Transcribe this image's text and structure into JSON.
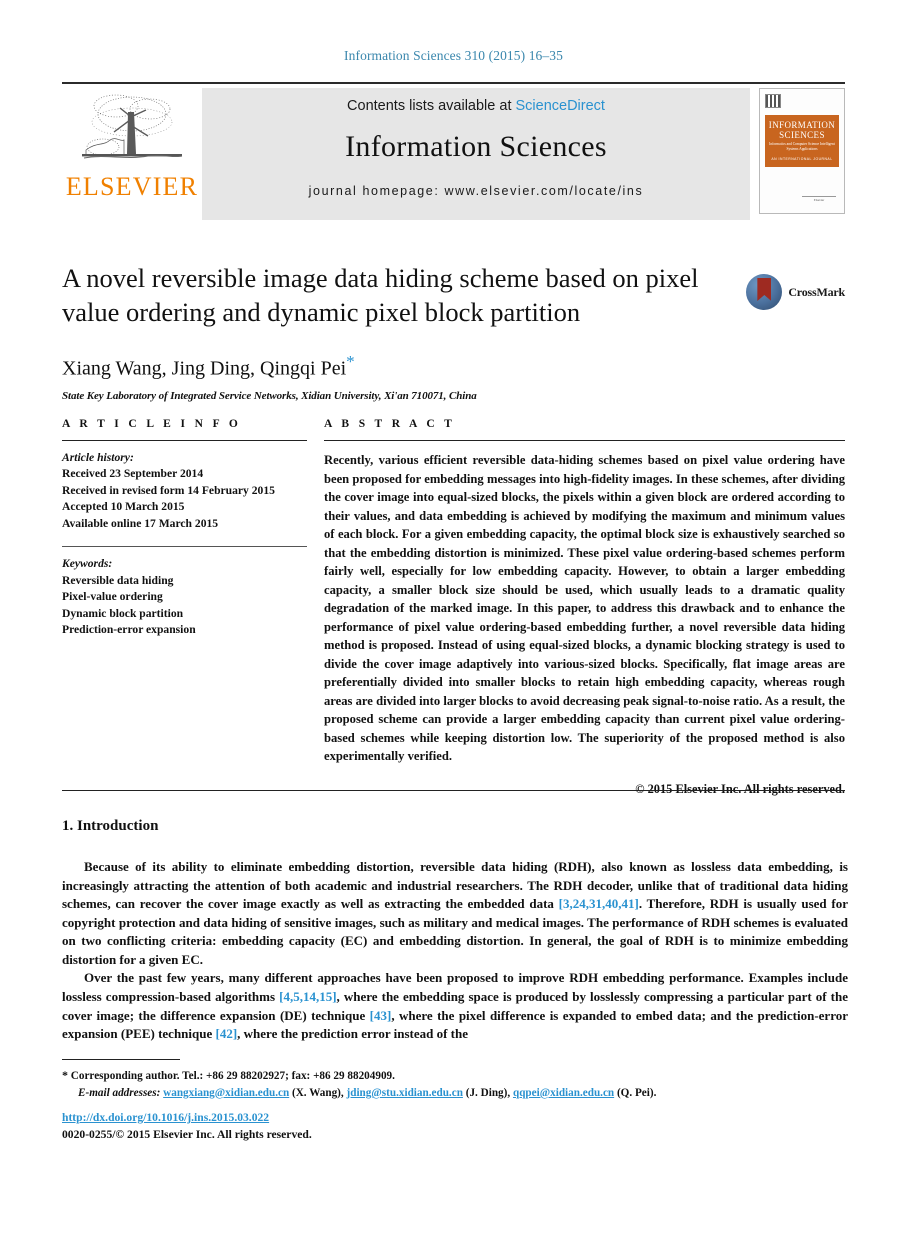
{
  "running_head": "Information Sciences 310 (2015) 16–35",
  "masthead": {
    "contents_prefix": "Contents lists available at ",
    "contents_link": "ScienceDirect",
    "journal_name": "Information Sciences",
    "homepage": "journal homepage: www.elsevier.com/locate/ins",
    "publisher_wordmark": "ELSEVIER",
    "cover": {
      "line1": "INFORMATION",
      "line2": "SCIENCES",
      "line3": "Informatics and Computer Science Intelligent Systems Applications",
      "line4": "AN INTERNATIONAL JOURNAL",
      "footer": "Elsevier"
    }
  },
  "title": "A novel reversible image data hiding scheme based on pixel value ordering and dynamic pixel block partition",
  "authors": "Xiang Wang, Jing Ding, Qingqi Pei",
  "author_star": "*",
  "affiliation": "State Key Laboratory of Integrated Service Networks, Xidian University, Xi'an 710071, China",
  "crossmark_label": "CrossMark",
  "article_info": {
    "heading": "A R T I C L E   I N F O",
    "history_label": "Article history:",
    "history": [
      "Received 23 September 2014",
      "Received in revised form 14 February 2015",
      "Accepted 10 March 2015",
      "Available online 17 March 2015"
    ],
    "keywords_label": "Keywords:",
    "keywords": [
      "Reversible data hiding",
      "Pixel-value ordering",
      "Dynamic block partition",
      "Prediction-error expansion"
    ]
  },
  "abstract": {
    "heading": "A B S T R A C T",
    "text": "Recently, various efficient reversible data-hiding schemes based on pixel value ordering have been proposed for embedding messages into high-fidelity images. In these schemes, after dividing the cover image into equal-sized blocks, the pixels within a given block are ordered according to their values, and data embedding is achieved by modifying the maximum and minimum values of each block. For a given embedding capacity, the optimal block size is exhaustively searched so that the embedding distortion is minimized. These pixel value ordering-based schemes perform fairly well, especially for low embedding capacity. However, to obtain a larger embedding capacity, a smaller block size should be used, which usually leads to a dramatic quality degradation of the marked image. In this paper, to address this drawback and to enhance the performance of pixel value ordering-based embedding further, a novel reversible data hiding method is proposed. Instead of using equal-sized blocks, a dynamic blocking strategy is used to divide the cover image adaptively into various-sized blocks. Specifically, flat image areas are preferentially divided into smaller blocks to retain high embedding capacity, whereas rough areas are divided into larger blocks to avoid decreasing peak signal-to-noise ratio. As a result, the proposed scheme can provide a larger embedding capacity than current pixel value ordering-based schemes while keeping distortion low. The superiority of the proposed method is also experimentally verified.",
    "copyright": "© 2015 Elsevier Inc. All rights reserved."
  },
  "section": {
    "heading": "1. Introduction",
    "para1_a": "Because of its ability to eliminate embedding distortion, reversible data hiding (RDH), also known as lossless data embedding, is increasingly attracting the attention of both academic and industrial researchers. The RDH decoder, unlike that of traditional data hiding schemes, can recover the cover image exactly as well as extracting the embedded data ",
    "para1_ref1": "[3,24,31,40,41]",
    "para1_b": ". Therefore, RDH is usually used for copyright protection and data hiding of sensitive images, such as military and medical images. The performance of RDH schemes is evaluated on two conflicting criteria: embedding capacity (EC) and embedding distortion. In general, the goal of RDH is to minimize embedding distortion for a given EC.",
    "para2_a": "Over the past few years, many different approaches have been proposed to improve RDH embedding performance. Examples include lossless compression-based algorithms ",
    "para2_ref1": "[4,5,14,15]",
    "para2_b": ", where the embedding space is produced by losslessly compressing a particular part of the cover image; the difference expansion (DE) technique ",
    "para2_ref2": "[43]",
    "para2_c": ", where the pixel difference is expanded to embed data; and the prediction-error expansion (PEE) technique ",
    "para2_ref3": "[42]",
    "para2_d": ", where the prediction error instead of the"
  },
  "footnotes": {
    "corresponding_marker": "*",
    "corresponding": "Corresponding author. Tel.: +86 29 88202927; fax: +86 29 88204909.",
    "email_label": "E-mail addresses:",
    "emails": [
      {
        "address": "wangxiang@xidian.edu.cn",
        "name": "(X. Wang),"
      },
      {
        "address": "jding@stu.xidian.edu.cn",
        "name": "(J. Ding),"
      },
      {
        "address": "qqpei@xidian.edu.cn",
        "name": "(Q. Pei)."
      }
    ],
    "doi": "http://dx.doi.org/10.1016/j.ins.2015.03.022",
    "issn_line": "0020-0255/© 2015 Elsevier Inc. All rights reserved."
  },
  "colors": {
    "link": "#2a92d0",
    "running_head": "#3a87ad",
    "elsevier_orange": "#f08000",
    "cover_band": "#c8651f"
  }
}
